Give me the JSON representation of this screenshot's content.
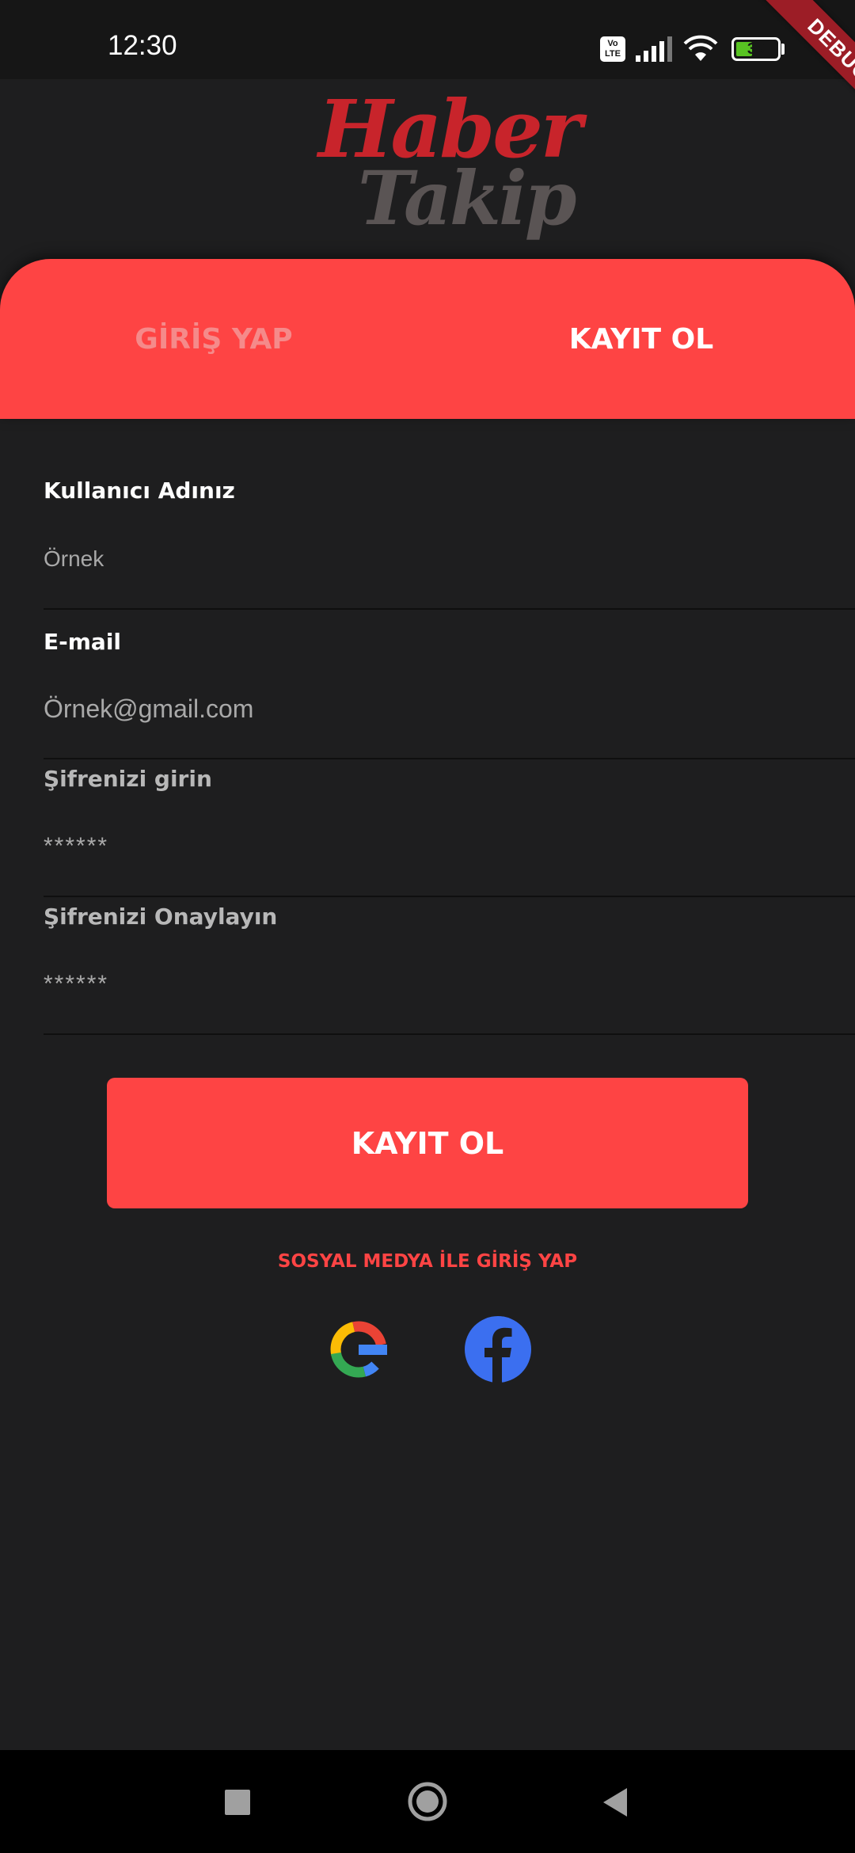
{
  "status_bar": {
    "time": "12:30",
    "volte": "Vo\nLTE",
    "battery": "39",
    "battery_level": 0.39
  },
  "debug_ribbon": "DEBUG",
  "logo": {
    "line1": "Haber",
    "line2": "Takip",
    "colors": {
      "line1": "#c8242b",
      "line2": "#5a5454"
    }
  },
  "tabs": {
    "login": "GİRİŞ YAP",
    "register": "KAYIT OL",
    "active": "register"
  },
  "form": {
    "username": {
      "label": "Kullanıcı Adınız",
      "value": "Örnek"
    },
    "email": {
      "label": "E-mail",
      "value": "Örnek@gmail.com"
    },
    "password": {
      "label": "Şifrenizi girin",
      "value": "******"
    },
    "password_confirm": {
      "label": "Şifrenizi Onaylayın",
      "value": "******"
    }
  },
  "register_button": "KAYIT OL",
  "social": {
    "label": "SOSYAL MEDYA İLE GİRİŞ YAP",
    "icons": [
      "google-icon",
      "facebook-icon"
    ]
  },
  "nav": {
    "icons": [
      "recents-square-icon",
      "home-circle-icon",
      "back-triangle-icon"
    ]
  },
  "colors": {
    "accent": "#fe4444",
    "background": "#1e1e1f",
    "status_bar": "#161616",
    "nav_bar": "#000000",
    "facebook": "#3b6ff0"
  }
}
